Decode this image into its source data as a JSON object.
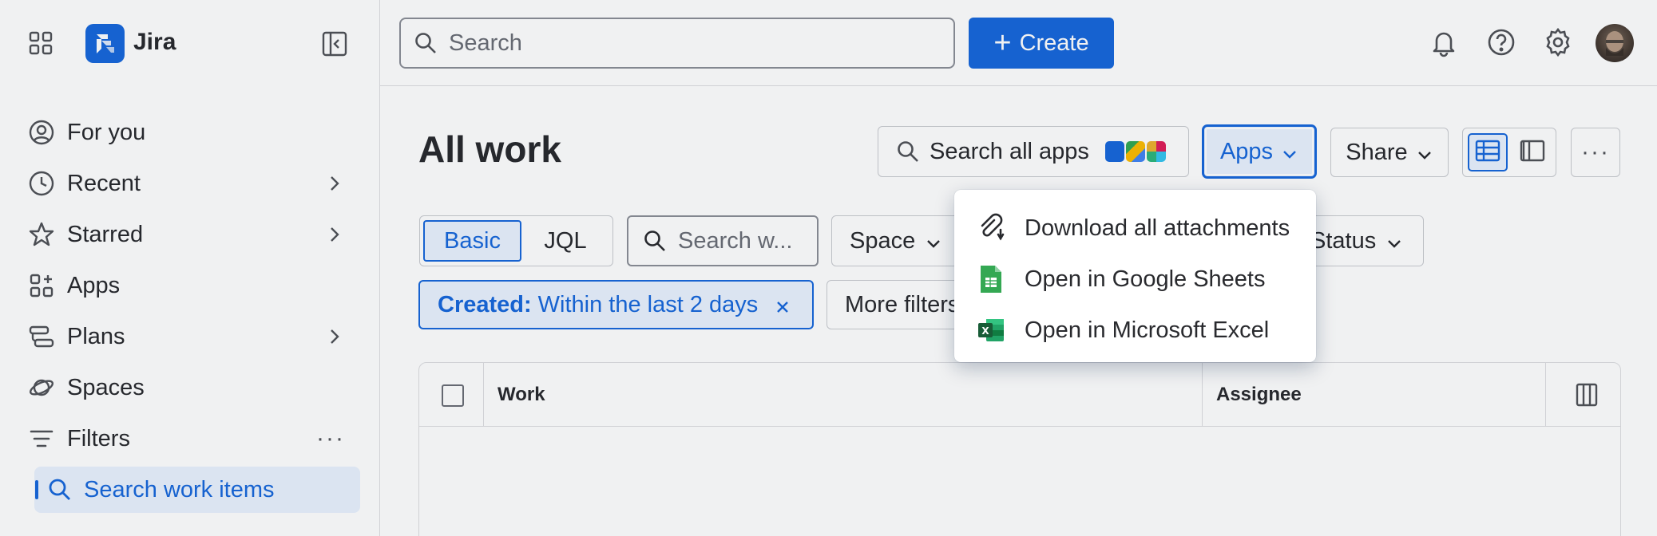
{
  "sidebar": {
    "app_name": "Jira",
    "items": [
      {
        "label": "For you",
        "icon": "person-circle-icon"
      },
      {
        "label": "Recent",
        "icon": "clock-icon"
      },
      {
        "label": "Starred",
        "icon": "star-icon"
      },
      {
        "label": "Apps",
        "icon": "apps-grid-icon"
      },
      {
        "label": "Plans",
        "icon": "plans-icon"
      },
      {
        "label": "Spaces",
        "icon": "planet-icon"
      },
      {
        "label": "Filters",
        "icon": "filter-icon"
      },
      {
        "label": "Search work items",
        "icon": "search-icon"
      }
    ]
  },
  "topbar": {
    "search_placeholder": "Search",
    "create_label": "Create"
  },
  "main": {
    "title": "All work",
    "apps_search_label": "Search all apps",
    "apps_button": "Apps",
    "share_button": "Share",
    "filters": {
      "basic": "Basic",
      "jql": "JQL",
      "search_placeholder": "Search w...",
      "space": "Space",
      "status": "Status",
      "chip_key": "Created:",
      "chip_value": "Within the last 2 days",
      "more_filters": "More filters"
    },
    "table": {
      "columns": [
        "Work",
        "Assignee"
      ]
    }
  },
  "apps_menu": {
    "items": [
      {
        "label": "Download all attachments",
        "icon": "attachment-download-icon"
      },
      {
        "label": "Open in Google Sheets",
        "icon": "google-sheets-icon"
      },
      {
        "label": "Open in Microsoft Excel",
        "icon": "microsoft-excel-icon"
      }
    ]
  },
  "colors": {
    "brand": "#1868db",
    "selected_bg": "#e9f2fe",
    "text": "#292a2e",
    "sheets_green": "#34a853",
    "excel_green": "#1d6f42"
  }
}
